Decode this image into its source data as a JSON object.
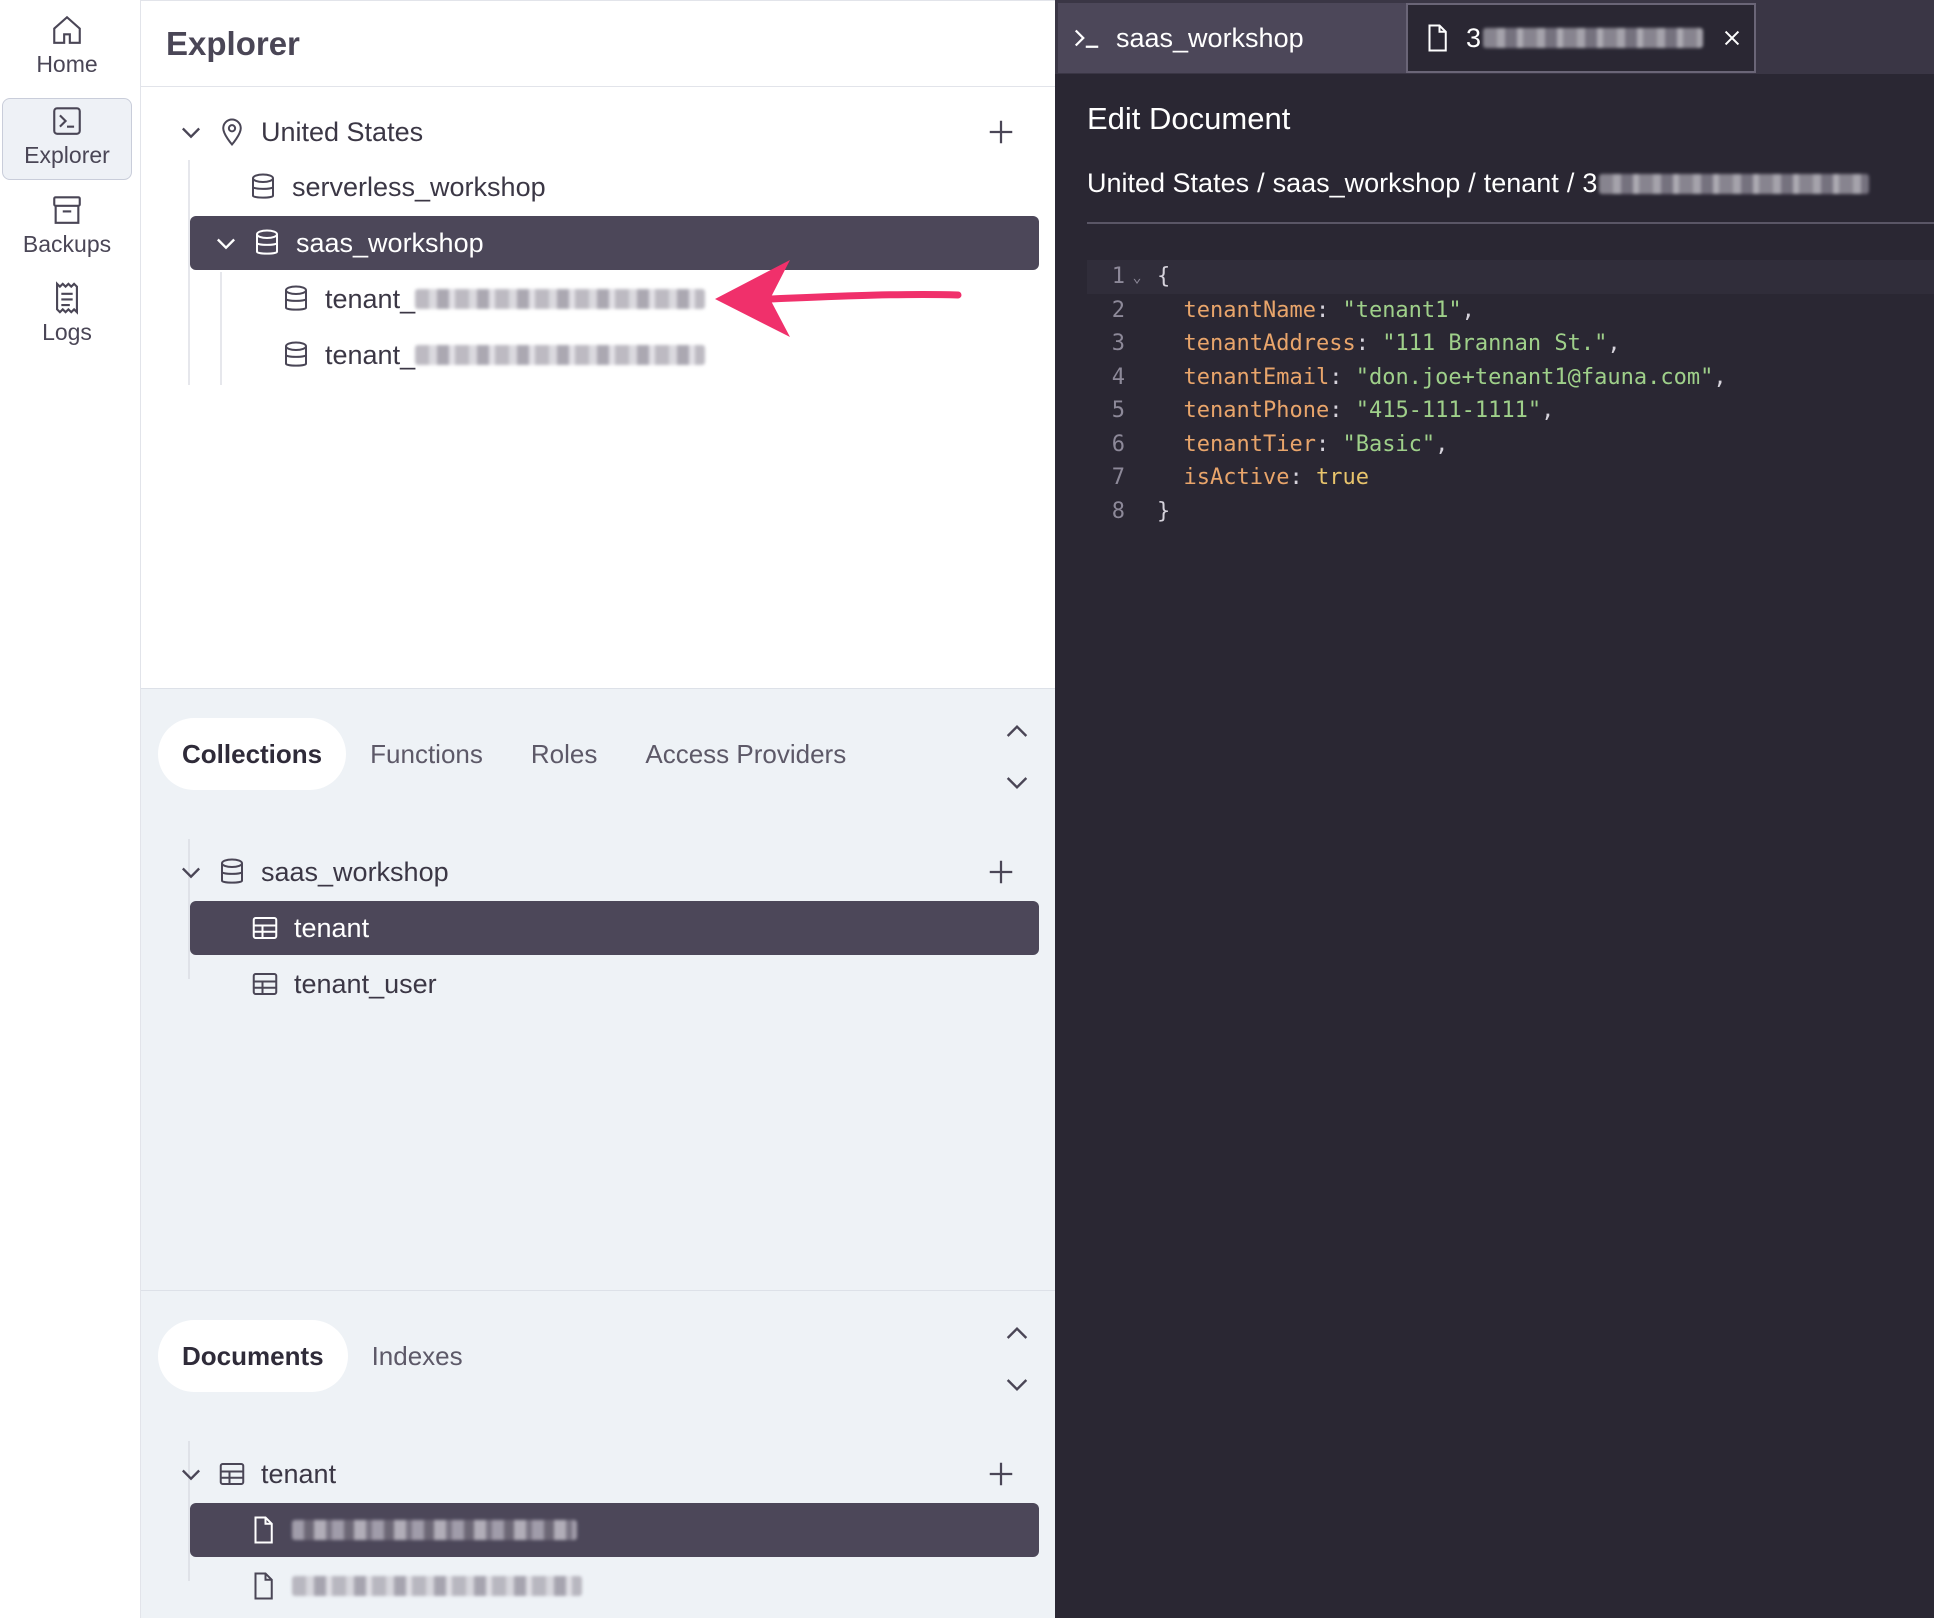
{
  "rail": {
    "items": [
      {
        "label": "Home",
        "icon": "home-icon",
        "active": false
      },
      {
        "label": "Explorer",
        "icon": "terminal-icon",
        "active": true
      },
      {
        "label": "Backups",
        "icon": "archive-icon",
        "active": false
      },
      {
        "label": "Logs",
        "icon": "log-icon",
        "active": false
      }
    ]
  },
  "explorer": {
    "title": "Explorer",
    "region": "United States",
    "databases": [
      {
        "name": "serverless_workshop",
        "selected": false
      },
      {
        "name": "saas_workshop",
        "selected": true
      },
      {
        "name": "tenant_",
        "selected": false,
        "redacted": true
      },
      {
        "name": "tenant_",
        "selected": false,
        "redacted": true
      }
    ]
  },
  "collections_panel": {
    "tabs": [
      "Collections",
      "Functions",
      "Roles",
      "Access Providers"
    ],
    "active_tab": "Collections",
    "database": "saas_workshop",
    "items": [
      {
        "name": "tenant",
        "selected": true
      },
      {
        "name": "tenant_user",
        "selected": false
      }
    ]
  },
  "documents_panel": {
    "tabs": [
      "Documents",
      "Indexes"
    ],
    "active_tab": "Documents",
    "collection": "tenant",
    "doc_count_visible": 2
  },
  "editor": {
    "tabs": [
      {
        "label": "saas_workshop",
        "icon": "shell-icon"
      },
      {
        "label": "3",
        "icon": "document-icon",
        "redacted": true,
        "closable": true
      }
    ],
    "title": "Edit Document",
    "breadcrumb": [
      "United States",
      "saas_workshop",
      "tenant",
      "3"
    ],
    "breadcrumb_separator": "/",
    "code_lines": [
      {
        "n": "1",
        "open": "{"
      },
      {
        "n": "2",
        "key": "tenantName",
        "value": "\"tenant1\"",
        "vtype": "s",
        "comma": ","
      },
      {
        "n": "3",
        "key": "tenantAddress",
        "value": "\"111 Brannan St.\"",
        "vtype": "s",
        "comma": ","
      },
      {
        "n": "4",
        "key": "tenantEmail",
        "value": "\"don.joe+tenant1@fauna.com\"",
        "vtype": "s",
        "comma": ","
      },
      {
        "n": "5",
        "key": "tenantPhone",
        "value": "\"415-111-1111\"",
        "vtype": "s",
        "comma": ","
      },
      {
        "n": "6",
        "key": "tenantTier",
        "value": "\"Basic\"",
        "vtype": "s",
        "comma": ","
      },
      {
        "n": "7",
        "key": "isActive",
        "value": "true",
        "vtype": "b",
        "comma": ""
      },
      {
        "n": "8",
        "open": "}"
      }
    ]
  },
  "colors": {
    "selected_row": "#4c4759",
    "editor_bg": "#2a2733",
    "annotation_arrow": "#f0306b",
    "json_key": "#e9a56b",
    "json_string": "#9fd08a",
    "json_bool": "#e8c46c"
  }
}
